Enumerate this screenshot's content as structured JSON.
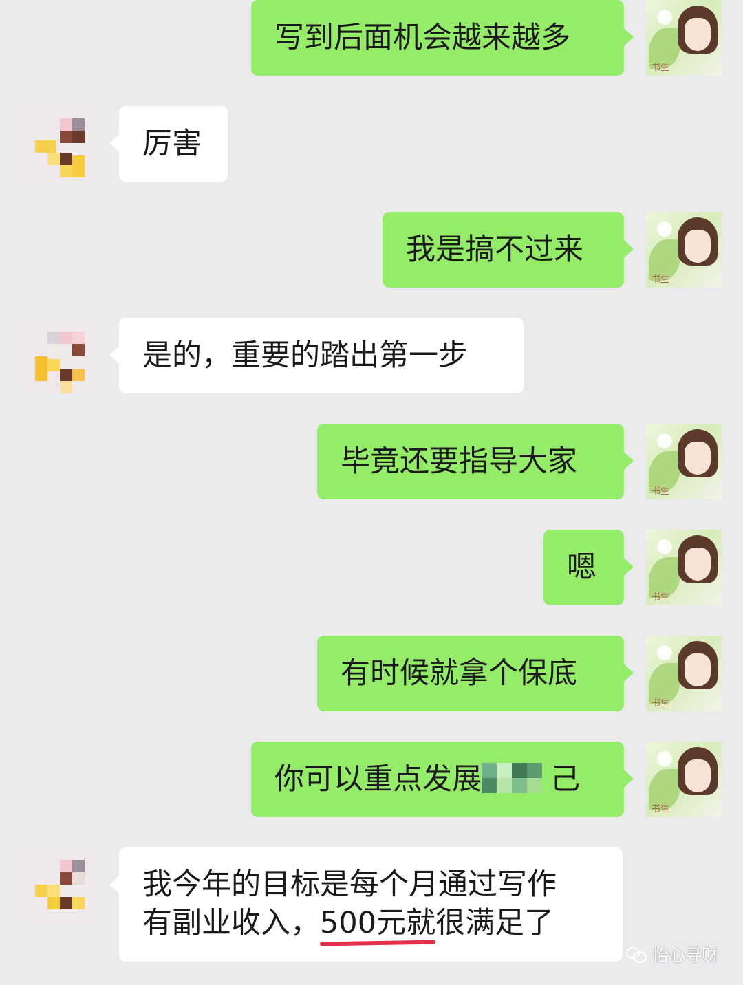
{
  "messages": [
    {
      "side": "right",
      "text": "写到后面机会越来越多"
    },
    {
      "side": "left",
      "text": "厉害"
    },
    {
      "side": "right",
      "text": "我是搞不过来"
    },
    {
      "side": "left",
      "text": "是的，重要的踏出第一步"
    },
    {
      "side": "right",
      "text": "毕竟还要指导大家"
    },
    {
      "side": "right",
      "text": "嗯"
    },
    {
      "side": "right",
      "text": "有时候就拿个保底"
    },
    {
      "side": "right",
      "text_prefix": "你可以重点发展",
      "text_suffix": "己"
    },
    {
      "side": "left",
      "line1": "我今年的目标是每个月通过写作",
      "line2_prefix": "有副业收入，",
      "line2_highlight": "500元就",
      "line2_suffix": "很满足了"
    }
  ],
  "self_avatar": {
    "signature": "书生"
  },
  "watermark": {
    "text": "怡心寻财",
    "icon": "wechat-channel-icon"
  },
  "colors": {
    "background": "#ebebee",
    "self_bubble": "#95ec69",
    "other_bubble": "#ffffff",
    "highlight_underline": "#e2304a"
  }
}
